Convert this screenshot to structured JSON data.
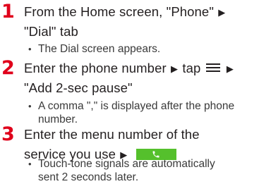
{
  "steps": [
    {
      "number": "1",
      "lines": [
        "From the Home screen, \"Phone\"",
        "\"Dial\" tab"
      ],
      "note": "The Dial screen appears."
    },
    {
      "number": "2",
      "line1_part1": "Enter the phone number",
      "line1_part2": "tap",
      "line2": "\"Add 2-sec pause\"",
      "note_line1": "A comma \",\" is displayed after the phone",
      "note_line2": "number."
    },
    {
      "number": "3",
      "line1": "Enter the menu number of the",
      "line2": "service you use",
      "note_line1": "Touch-tone signals are automatically",
      "note_line2": "sent 2 seconds later."
    }
  ],
  "glyphs": {
    "arrow": "▶",
    "bullet": "•"
  },
  "icons": {
    "menu": "menu-icon",
    "call": "call-button-phone-icon"
  },
  "colors": {
    "step_number": "#e0001b",
    "call_button": "#55c02c"
  }
}
